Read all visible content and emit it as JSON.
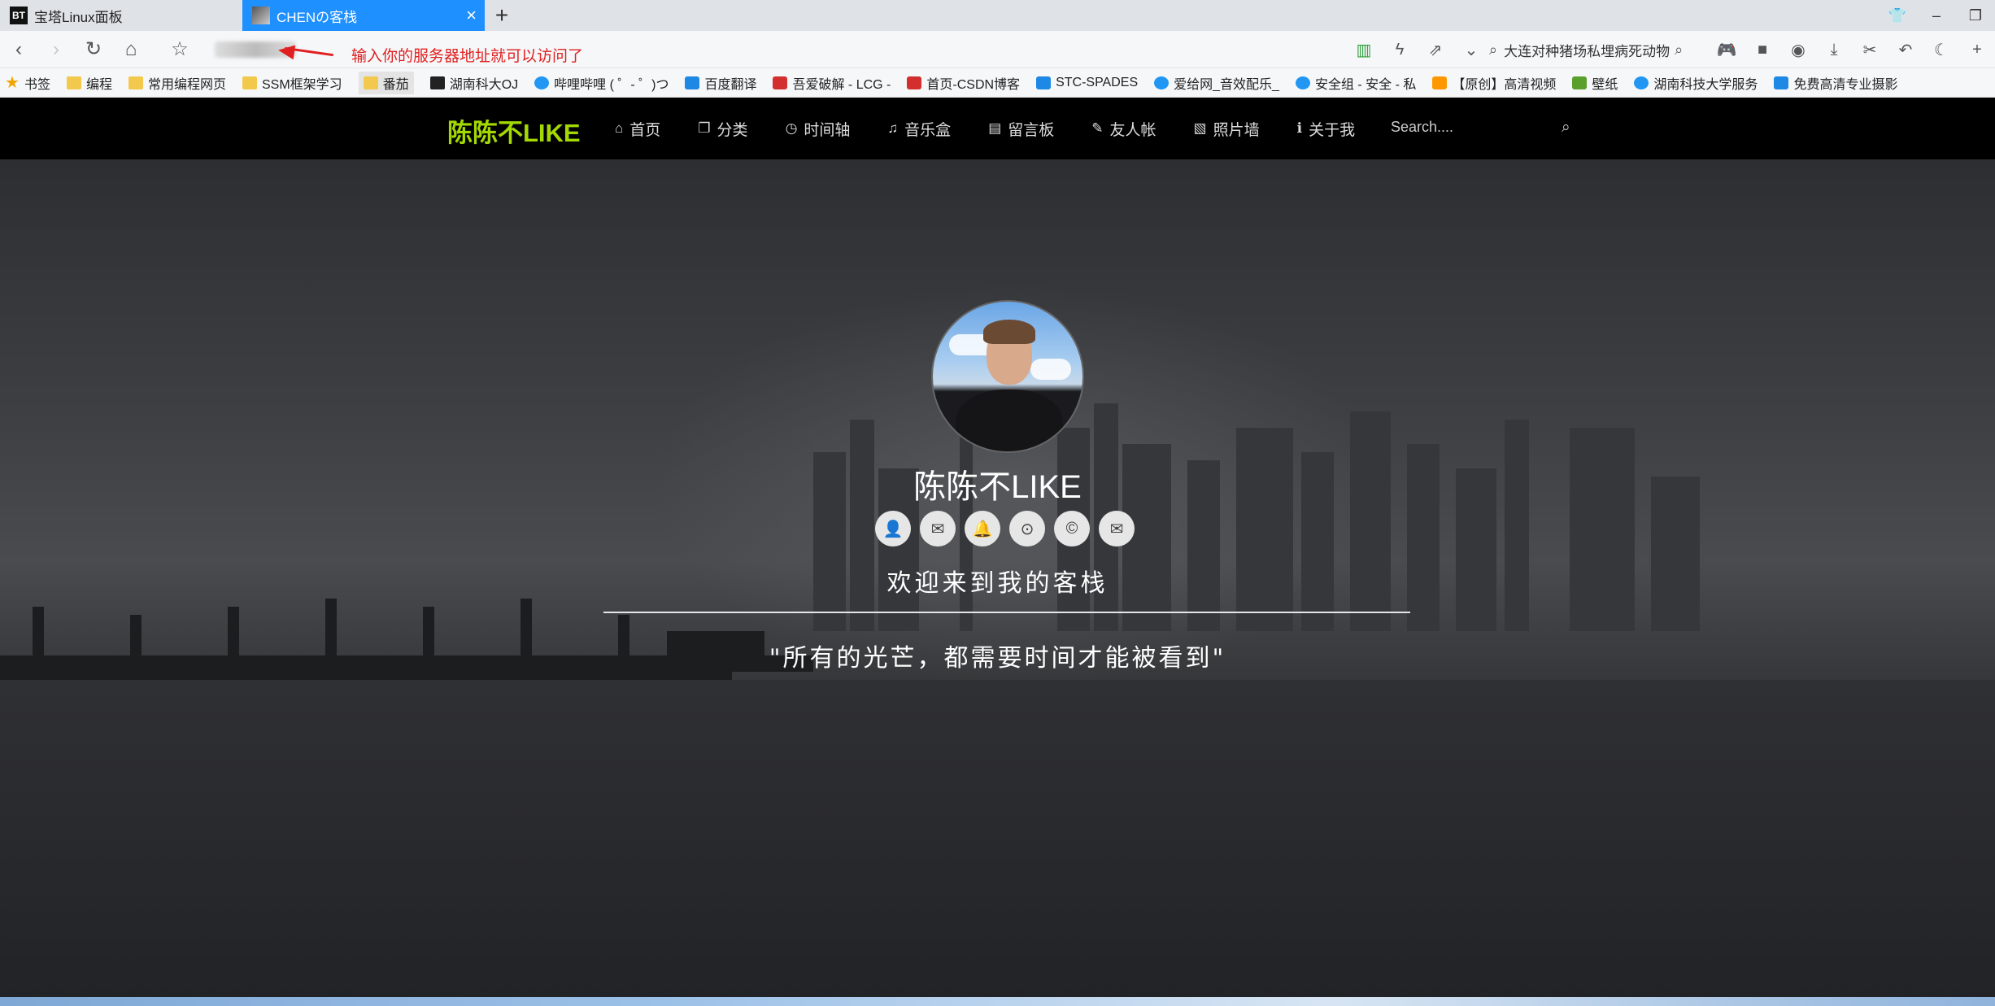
{
  "browser": {
    "tabs": [
      {
        "icon": "BT",
        "title": "宝塔Linux面板",
        "active": false
      },
      {
        "title": "CHENの客栈",
        "active": true
      }
    ],
    "new_tab": "+",
    "annotation": "输入你的服务器地址就可以访问了",
    "search_query": "大连对种猪场私埋病死动物",
    "bookmarks": [
      "书签",
      "编程",
      "常用编程网页",
      "SSM框架学习",
      "番茄",
      "湖南科大OJ",
      "哔哩哔哩 ( ゜- ゜)つ",
      "百度翻译",
      "吾爱破解 - LCG - ",
      "首页-CSDN博客",
      "STC-SPADES",
      "爱给网_音效配乐_",
      "安全组 - 安全 - 私",
      "【原创】高清视频",
      "壁纸",
      "湖南科技大学服务",
      "免费高清专业摄影"
    ]
  },
  "site": {
    "logo": "陈陈不LIKE",
    "menu": [
      {
        "icon": "home-icon",
        "glyph": "⌂",
        "label": "首页"
      },
      {
        "icon": "copy-icon",
        "glyph": "❐",
        "label": "分类"
      },
      {
        "icon": "clock-icon",
        "glyph": "◷",
        "label": "时间轴"
      },
      {
        "icon": "music-icon",
        "glyph": "♫",
        "label": "音乐盒"
      },
      {
        "icon": "book-icon",
        "glyph": "▤",
        "label": "留言板"
      },
      {
        "icon": "pencil-icon",
        "glyph": "✎",
        "label": "友人帐"
      },
      {
        "icon": "image-icon",
        "glyph": "▧",
        "label": "照片墙"
      },
      {
        "icon": "info-icon",
        "glyph": "ℹ",
        "label": "关于我"
      }
    ],
    "search_placeholder": "Search....",
    "hero": {
      "title": "陈陈不LIKE",
      "welcome": "欢迎来到我的客栈",
      "quote": "\"所有的光芒，都需要时间才能被看到\""
    },
    "socials": [
      {
        "icon": "user-icon",
        "glyph": "👤"
      },
      {
        "icon": "wechat-icon",
        "glyph": "✉"
      },
      {
        "icon": "qq-icon",
        "glyph": "🔔"
      },
      {
        "icon": "github-icon",
        "glyph": "⊙"
      },
      {
        "icon": "copyright-icon",
        "glyph": "©"
      },
      {
        "icon": "mail-icon",
        "glyph": "✉"
      }
    ]
  }
}
